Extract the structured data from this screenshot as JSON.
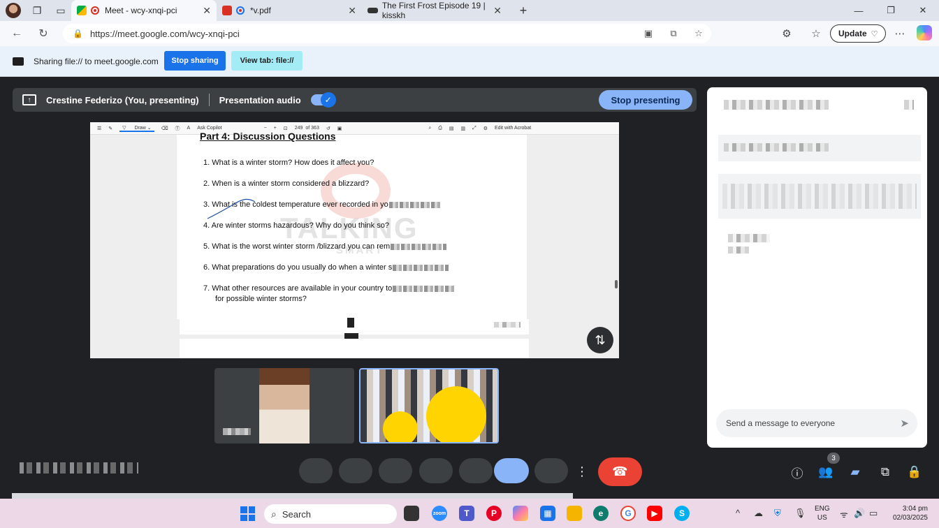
{
  "browser": {
    "tabs": [
      {
        "title": "Meet - wcy-xnqi-pci",
        "active": true
      },
      {
        "title": "*v.pdf",
        "active": false
      },
      {
        "title": "The First Frost Episode 19 | kisskh",
        "active": false
      }
    ],
    "new_tab_icon": "plus-icon",
    "url": "https://meet.google.com/wcy-xnqi-pci",
    "update_label": "Update"
  },
  "share_bar": {
    "text": "Sharing file:// to meet.google.com",
    "stop_sharing_label": "Stop sharing",
    "view_tab_label": "View tab: file://"
  },
  "meet": {
    "presenter_label": "Crestine Federizo (You, presenting)",
    "presentation_audio_label": "Presentation audio",
    "presentation_audio_on": true,
    "stop_presenting_label": "Stop presenting",
    "participants_count": "3",
    "accent_color": "#8ab4f8",
    "hangup_color": "#ea4335"
  },
  "pdf_viewer": {
    "toolbar": {
      "draw_label": "Draw",
      "ask_copilot_label": "Ask Copilot",
      "page_current": "249",
      "page_total": "of 363",
      "edit_label": "Edit with Acrobat"
    },
    "heading": "Part 4: Discussion Questions",
    "questions": [
      "1.  What is a winter storm? How does it affect you?",
      "2. When is a winter storm considered a blizzard?",
      "3. What is the coldest temperature ever recorded in yo",
      "4. Are winter storms hazardous? Why do you think so?",
      "5. What is the worst winter storm /blizzard you can rem",
      "6. What preparations do you usually do when a winter s",
      "7. What other resources are available in your country to"
    ],
    "question7_cont": "for possible winter storms?",
    "watermark_main": "TALKING",
    "watermark_sub": "SMART"
  },
  "chat": {
    "input_placeholder": "Send a message to everyone"
  },
  "taskbar": {
    "search_placeholder": "Search",
    "lang_line1": "ENG",
    "lang_line2": "US",
    "time": "3:04 pm",
    "date": "02/03/2025"
  }
}
